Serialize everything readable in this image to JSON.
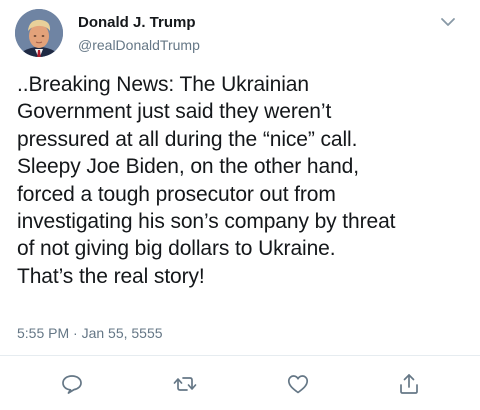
{
  "author": {
    "name": "Donald J. Trump",
    "handle": "@realDonaldTrump",
    "avatar_icon": "profile-photo"
  },
  "menu": {
    "icon": "chevron-down-icon"
  },
  "tweet": {
    "text": "..Breaking News: The Ukrainian\nGovernment just said they weren’t\npressured at all during the “nice” call.\nSleepy Joe Biden, on the other hand,\nforced a tough prosecutor out from\ninvestigating his son’s company by threat\nof not giving big dollars to Ukraine.\nThat’s the real story!",
    "timestamp": "5:55 PM · Jan 55, 5555"
  },
  "actions": {
    "reply_icon": "reply-icon",
    "retweet_icon": "retweet-icon",
    "like_icon": "heart-icon",
    "share_icon": "share-icon"
  },
  "colors": {
    "text": "#14171a",
    "secondary": "#657786",
    "divider": "#e6ecf0"
  }
}
